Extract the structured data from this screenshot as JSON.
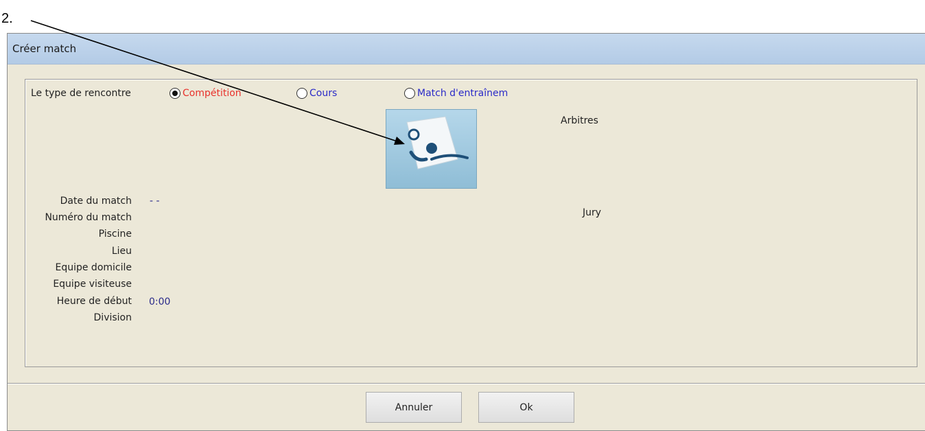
{
  "step_label": "2.",
  "window": {
    "title": "Créer match"
  },
  "match_type": {
    "label": "Le type de rencontre",
    "options": [
      {
        "label": "Compétition",
        "selected": true,
        "color": "#e8322c"
      },
      {
        "label": "Cours",
        "selected": false,
        "color": "#2b2bc8"
      },
      {
        "label": "Match d'entraînem",
        "selected": false,
        "color": "#2b2bc8"
      }
    ]
  },
  "image_button": {
    "icon": "referee-whistle-icon"
  },
  "right_labels": {
    "arbitres": "Arbitres",
    "jury": "Jury"
  },
  "fields": [
    {
      "label": "Date du match",
      "value": "- -"
    },
    {
      "label": "Numéro du match",
      "value": ""
    },
    {
      "label": "Piscine",
      "value": ""
    },
    {
      "label": "Lieu",
      "value": ""
    },
    {
      "label": "Equipe domicile",
      "value": ""
    },
    {
      "label": "Equipe visiteuse",
      "value": ""
    },
    {
      "label": "Heure de début",
      "value": "0:00"
    },
    {
      "label": "Division",
      "value": ""
    }
  ],
  "buttons": {
    "cancel": "Annuler",
    "ok": "Ok"
  }
}
